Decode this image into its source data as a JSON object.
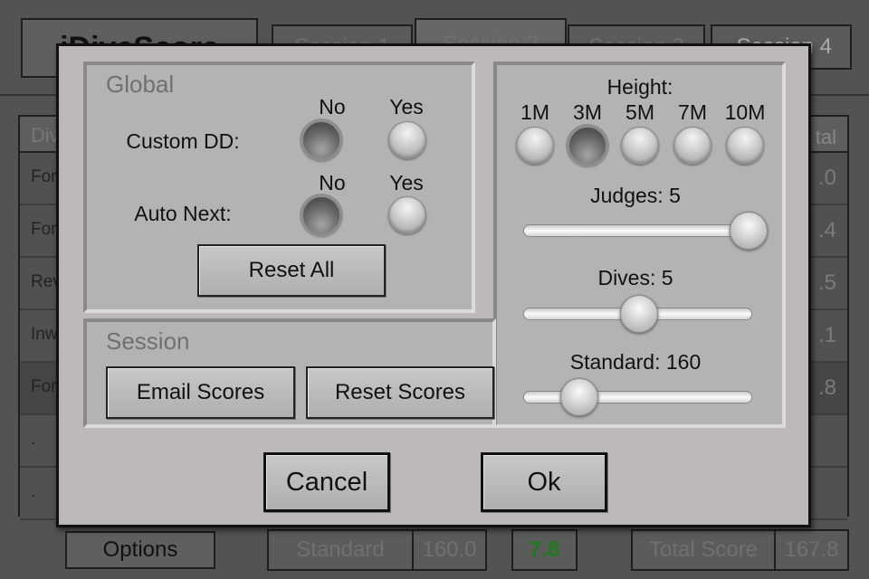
{
  "app": {
    "title": "iDiveScore",
    "tabs": [
      "Session 1",
      "Session 2",
      "Session 3",
      "Session 4"
    ],
    "selected_tab": 1
  },
  "table": {
    "header_left": "Div",
    "header_right": "tal",
    "rows": [
      {
        "left": "For",
        "right": ".0"
      },
      {
        "left": "For",
        "right": ".4"
      },
      {
        "left": "Rev",
        "right": ".5"
      },
      {
        "left": "Inw",
        "right": ".1"
      },
      {
        "left": "For",
        "right": ".8"
      },
      {
        "left": ".",
        "right": ""
      },
      {
        "left": ".",
        "right": ""
      }
    ]
  },
  "footer": {
    "options": "Options",
    "standard_label": "Standard",
    "standard_value": "160.0",
    "dd_value": "7.8",
    "total_label": "Total Score",
    "total_value": "167.8",
    "accent": "#1e7a1e"
  },
  "dialog": {
    "global": {
      "title": "Global",
      "no": "No",
      "yes": "Yes",
      "custom_dd": {
        "label": "Custom DD:",
        "value": "No"
      },
      "auto_next": {
        "label": "Auto Next:",
        "value": "No"
      },
      "reset_all": "Reset All"
    },
    "session": {
      "title": "Session",
      "email": "Email Scores",
      "reset": "Reset Scores"
    },
    "height": {
      "label": "Height:",
      "options": [
        "1M",
        "3M",
        "5M",
        "7M",
        "10M"
      ],
      "selected": "3M"
    },
    "judges": {
      "label": "Judges: 5",
      "value": 5,
      "fraction": 1.0
    },
    "dives": {
      "label": "Dives: 5",
      "value": 5,
      "fraction": 0.5
    },
    "standard": {
      "label": "Standard: 160",
      "value": 160,
      "fraction": 0.2
    },
    "cancel": "Cancel",
    "ok": "Ok"
  }
}
